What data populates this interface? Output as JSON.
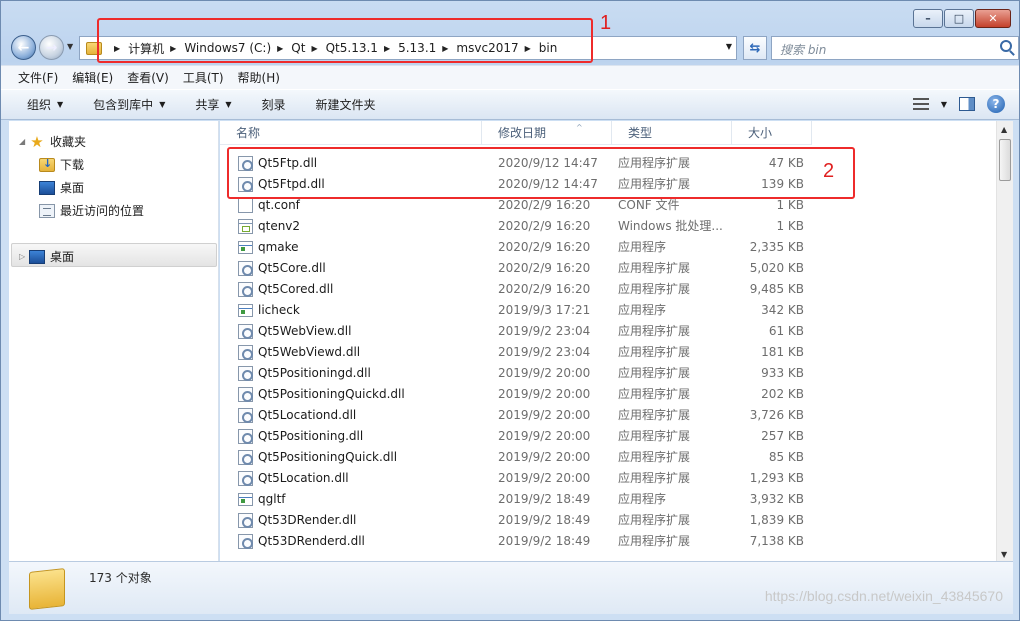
{
  "window": {
    "caption_buttons": [
      "–",
      "□",
      "✕"
    ]
  },
  "address": {
    "crumbs": [
      "计算机",
      "Windows7 (C:)",
      "Qt",
      "Qt5.13.1",
      "5.13.1",
      "msvc2017",
      "bin"
    ],
    "search_placeholder": "搜索 bin"
  },
  "menu": [
    "文件(F)",
    "编辑(E)",
    "查看(V)",
    "工具(T)",
    "帮助(H)"
  ],
  "commands": {
    "organize": "组织",
    "include_library": "包含到库中",
    "share": "共享",
    "burn": "刻录",
    "new_folder": "新建文件夹"
  },
  "nav": {
    "favorites": "收藏夹",
    "downloads": "下载",
    "desktop_fav": "桌面",
    "recent": "最近访问的位置",
    "desktop": "桌面"
  },
  "columns": {
    "name": "名称",
    "date": "修改日期",
    "type": "类型",
    "size": "大小"
  },
  "files": [
    {
      "name": "Qt5Ftp.dll",
      "date": "2020/9/12 14:47",
      "type": "应用程序扩展",
      "size": "47 KB",
      "icon": "dll"
    },
    {
      "name": "Qt5Ftpd.dll",
      "date": "2020/9/12 14:47",
      "type": "应用程序扩展",
      "size": "139 KB",
      "icon": "dll"
    },
    {
      "name": "qt.conf",
      "date": "2020/2/9 16:20",
      "type": "CONF 文件",
      "size": "1 KB",
      "icon": "conf"
    },
    {
      "name": "qtenv2",
      "date": "2020/2/9 16:20",
      "type": "Windows 批处理...",
      "size": "1 KB",
      "icon": "bat"
    },
    {
      "name": "qmake",
      "date": "2020/2/9 16:20",
      "type": "应用程序",
      "size": "2,335 KB",
      "icon": "exe"
    },
    {
      "name": "Qt5Core.dll",
      "date": "2020/2/9 16:20",
      "type": "应用程序扩展",
      "size": "5,020 KB",
      "icon": "dll"
    },
    {
      "name": "Qt5Cored.dll",
      "date": "2020/2/9 16:20",
      "type": "应用程序扩展",
      "size": "9,485 KB",
      "icon": "dll"
    },
    {
      "name": "licheck",
      "date": "2019/9/3 17:21",
      "type": "应用程序",
      "size": "342 KB",
      "icon": "exe"
    },
    {
      "name": "Qt5WebView.dll",
      "date": "2019/9/2 23:04",
      "type": "应用程序扩展",
      "size": "61 KB",
      "icon": "dll"
    },
    {
      "name": "Qt5WebViewd.dll",
      "date": "2019/9/2 23:04",
      "type": "应用程序扩展",
      "size": "181 KB",
      "icon": "dll"
    },
    {
      "name": "Qt5Positioningd.dll",
      "date": "2019/9/2 20:00",
      "type": "应用程序扩展",
      "size": "933 KB",
      "icon": "dll"
    },
    {
      "name": "Qt5PositioningQuickd.dll",
      "date": "2019/9/2 20:00",
      "type": "应用程序扩展",
      "size": "202 KB",
      "icon": "dll"
    },
    {
      "name": "Qt5Locationd.dll",
      "date": "2019/9/2 20:00",
      "type": "应用程序扩展",
      "size": "3,726 KB",
      "icon": "dll"
    },
    {
      "name": "Qt5Positioning.dll",
      "date": "2019/9/2 20:00",
      "type": "应用程序扩展",
      "size": "257 KB",
      "icon": "dll"
    },
    {
      "name": "Qt5PositioningQuick.dll",
      "date": "2019/9/2 20:00",
      "type": "应用程序扩展",
      "size": "85 KB",
      "icon": "dll"
    },
    {
      "name": "Qt5Location.dll",
      "date": "2019/9/2 20:00",
      "type": "应用程序扩展",
      "size": "1,293 KB",
      "icon": "dll"
    },
    {
      "name": "qgltf",
      "date": "2019/9/2 18:49",
      "type": "应用程序",
      "size": "3,932 KB",
      "icon": "exe"
    },
    {
      "name": "Qt53DRender.dll",
      "date": "2019/9/2 18:49",
      "type": "应用程序扩展",
      "size": "1,839 KB",
      "icon": "dll"
    },
    {
      "name": "Qt53DRenderd.dll",
      "date": "2019/9/2 18:49",
      "type": "应用程序扩展",
      "size": "7,138 KB",
      "icon": "dll"
    }
  ],
  "status": {
    "count": "173 个对象"
  },
  "annotations": [
    "1",
    "2"
  ],
  "watermark": "https://blog.csdn.net/weixin_43845670",
  "colors": {
    "annotation": "#ee2b2b",
    "accent": "#3e6ea8"
  }
}
